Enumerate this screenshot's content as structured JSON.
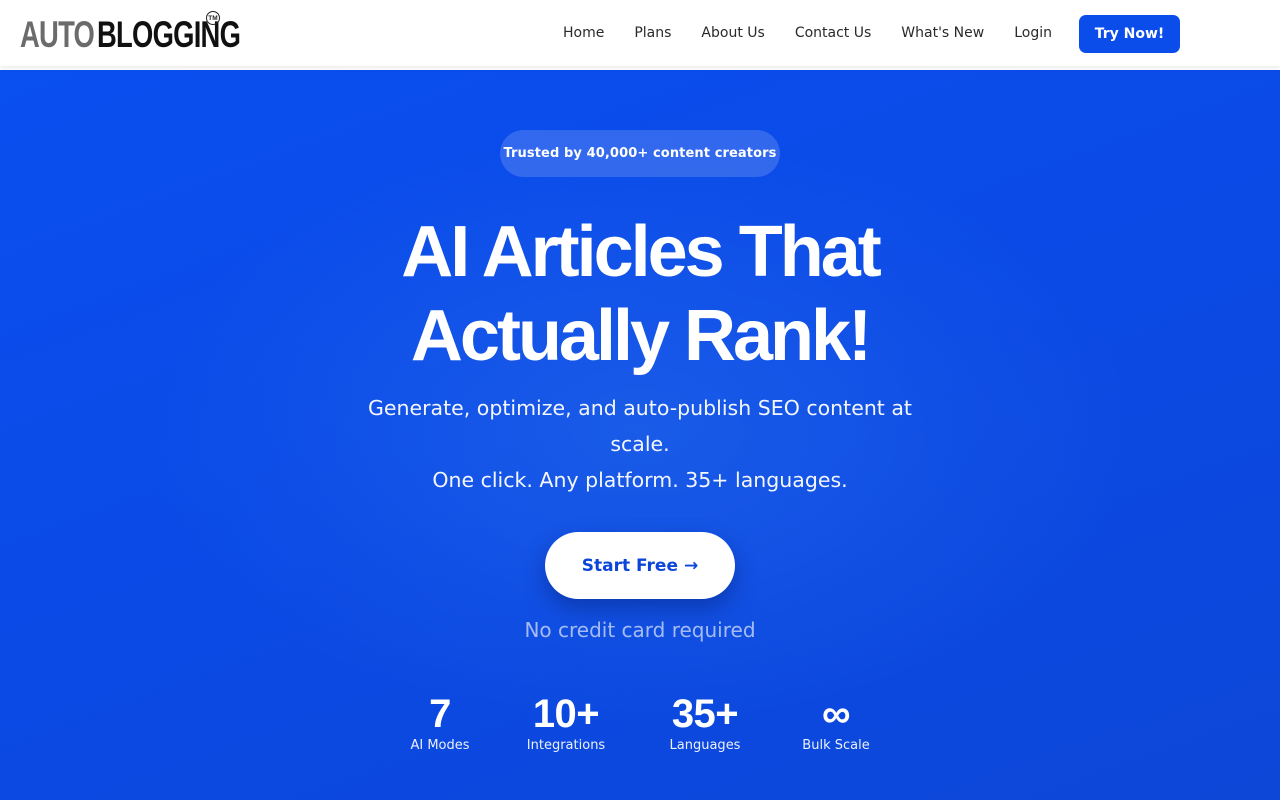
{
  "header": {
    "logo": {
      "part1": "AUTO",
      "part2": "BLOGGING",
      "trademark": "TM"
    },
    "nav": [
      {
        "label": "Home"
      },
      {
        "label": "Plans"
      },
      {
        "label": "About Us"
      },
      {
        "label": "Contact Us"
      },
      {
        "label": "What's New"
      },
      {
        "label": "Login"
      }
    ],
    "cta_label": "Try Now!"
  },
  "hero": {
    "trust_badge": "Trusted by 40,000+ content creators",
    "headline_line1": "AI Articles That",
    "headline_line2": "Actually Rank!",
    "subhead_line1": "Generate, optimize, and auto-publish SEO content at scale.",
    "subhead_line2": "One click. Any platform. 35+ languages.",
    "cta_label": "Start Free",
    "cta_arrow": "→",
    "note": "No credit card required",
    "stats": [
      {
        "value": "7",
        "label": "AI Modes"
      },
      {
        "value": "10+",
        "label": "Integrations"
      },
      {
        "value": "35+",
        "label": "Languages"
      },
      {
        "value": "∞",
        "label": "Bulk Scale"
      }
    ]
  },
  "colors": {
    "brand_blue": "#0b4dea",
    "hero_gradient_start": "#0a4ff0",
    "hero_gradient_end": "#0d47d8"
  }
}
